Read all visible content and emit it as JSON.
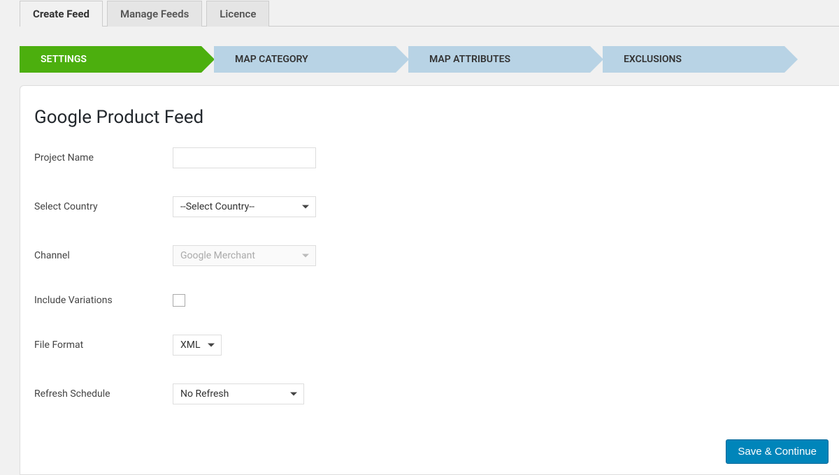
{
  "tabs": [
    {
      "label": "Create Feed",
      "active": true
    },
    {
      "label": "Manage Feeds",
      "active": false
    },
    {
      "label": "Licence",
      "active": false
    }
  ],
  "steps": [
    {
      "label": "SETTINGS",
      "active": true
    },
    {
      "label": "MAP CATEGORY",
      "active": false
    },
    {
      "label": "MAP ATTRIBUTES",
      "active": false
    },
    {
      "label": "EXCLUSIONS",
      "active": false
    }
  ],
  "form": {
    "title": "Google Product Feed",
    "projectNameLabel": "Project Name",
    "projectNameValue": "",
    "selectCountryLabel": "Select Country",
    "selectCountryValue": "--Select Country--",
    "channelLabel": "Channel",
    "channelValue": "Google Merchant",
    "includeVariationsLabel": "Include Variations",
    "includeVariationsChecked": false,
    "fileFormatLabel": "File Format",
    "fileFormatValue": "XML",
    "refreshScheduleLabel": "Refresh Schedule",
    "refreshScheduleValue": "No Refresh"
  },
  "buttons": {
    "saveContinue": "Save & Continue"
  }
}
